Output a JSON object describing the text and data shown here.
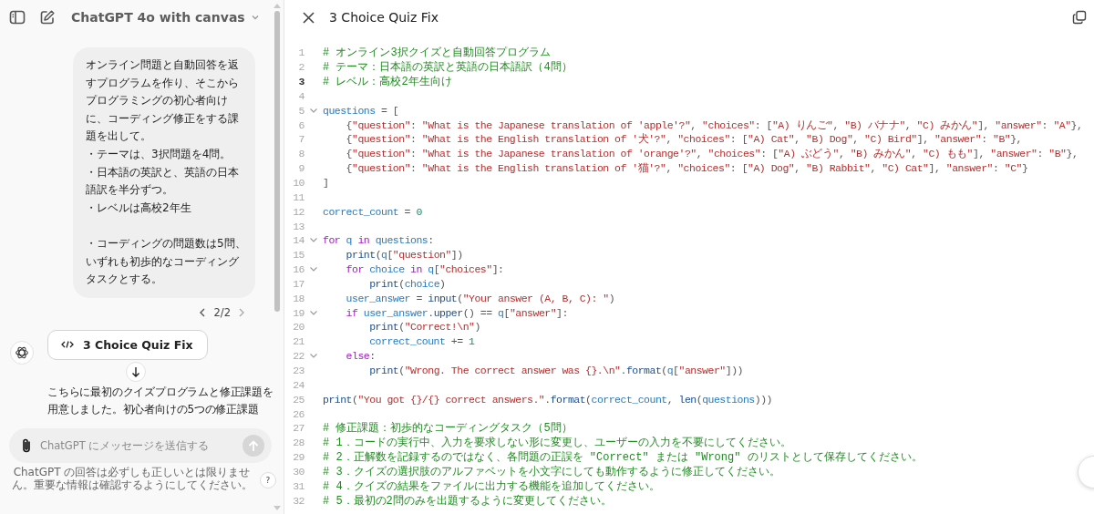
{
  "sidebar": {
    "title": "ChatGPT 4o with canvas",
    "messages": [
      {
        "kind": "user",
        "paragraphs": [
          [
            "オンライン問題と自動回答を返すプログラムを作り、そこからプログラミングの初心者向けに、コーディング修正をする課題を出して。",
            "・テーマは、3択問題を4問。",
            "・日本語の英訳と、英語の日本語訳を半分ずつ。",
            "・レベルは高校2年生"
          ],
          [
            "・コーディングの問題数は5問、いずれも初歩的なコーディングタスクとする。"
          ]
        ],
        "pager": "2/2"
      },
      {
        "kind": "assistant",
        "chip": "3 Choice Quiz Fix",
        "text": "こちらに最初のクイズプログラムと修正課題を用意しました。初心者向けの5つの修正課題"
      }
    ],
    "composer": {
      "placeholder": "ChatGPT にメッセージを送信する",
      "send_disabled": true
    },
    "disclaimer": "ChatGPT の回答は必ずしも正しいとは限りません。重要な情報は確認するようにしてください。",
    "help": "?"
  },
  "canvas": {
    "title": "3 Choice Quiz Fix",
    "lines": [
      {
        "number": "1",
        "foldable": false,
        "active": false,
        "tokens": [
          {
            "kind": "comment",
            "text": "# オンライン3択クイズと自動回答プログラム"
          }
        ]
      },
      {
        "number": "2",
        "foldable": false,
        "active": false,
        "tokens": [
          {
            "kind": "comment",
            "text": "# テーマ：日本語の英訳と英語の日本語訳（4問）"
          }
        ]
      },
      {
        "number": "3",
        "foldable": false,
        "active": true,
        "tokens": [
          {
            "kind": "comment",
            "text": "# レベル：高校2年生向け"
          }
        ]
      },
      {
        "number": "4",
        "foldable": false,
        "active": false
      },
      {
        "number": "5",
        "foldable": true,
        "active": false,
        "tokens": [
          {
            "kind": "variable",
            "text": "questions"
          },
          {
            "kind": "plain",
            "text": " = ["
          }
        ]
      },
      {
        "number": "6",
        "foldable": false,
        "active": false,
        "tokens": [
          {
            "kind": "plain",
            "text": "    {"
          },
          {
            "kind": "string",
            "text": "\"question\""
          },
          {
            "kind": "plain",
            "text": ": "
          },
          {
            "kind": "string",
            "text": "\"What is the Japanese translation of 'apple'?\""
          },
          {
            "kind": "plain",
            "text": ", "
          },
          {
            "kind": "string",
            "text": "\"choices\""
          },
          {
            "kind": "plain",
            "text": ": ["
          },
          {
            "kind": "string",
            "text": "\"A) りんご\""
          },
          {
            "kind": "plain",
            "text": ", "
          },
          {
            "kind": "string",
            "text": "\"B) バナナ\""
          },
          {
            "kind": "plain",
            "text": ", "
          },
          {
            "kind": "string",
            "text": "\"C) みかん\""
          },
          {
            "kind": "plain",
            "text": "], "
          },
          {
            "kind": "string",
            "text": "\"answer\""
          },
          {
            "kind": "plain",
            "text": ": "
          },
          {
            "kind": "string",
            "text": "\"A\""
          },
          {
            "kind": "plain",
            "text": "},"
          }
        ]
      },
      {
        "number": "7",
        "foldable": false,
        "active": false,
        "tokens": [
          {
            "kind": "plain",
            "text": "    {"
          },
          {
            "kind": "string",
            "text": "\"question\""
          },
          {
            "kind": "plain",
            "text": ": "
          },
          {
            "kind": "string",
            "text": "\"What is the English translation of '犬'?\""
          },
          {
            "kind": "plain",
            "text": ", "
          },
          {
            "kind": "string",
            "text": "\"choices\""
          },
          {
            "kind": "plain",
            "text": ": ["
          },
          {
            "kind": "string",
            "text": "\"A) Cat\""
          },
          {
            "kind": "plain",
            "text": ", "
          },
          {
            "kind": "string",
            "text": "\"B) Dog\""
          },
          {
            "kind": "plain",
            "text": ", "
          },
          {
            "kind": "string",
            "text": "\"C) Bird\""
          },
          {
            "kind": "plain",
            "text": "], "
          },
          {
            "kind": "string",
            "text": "\"answer\""
          },
          {
            "kind": "plain",
            "text": ": "
          },
          {
            "kind": "string",
            "text": "\"B\""
          },
          {
            "kind": "plain",
            "text": "},"
          }
        ]
      },
      {
        "number": "8",
        "foldable": false,
        "active": false,
        "tokens": [
          {
            "kind": "plain",
            "text": "    {"
          },
          {
            "kind": "string",
            "text": "\"question\""
          },
          {
            "kind": "plain",
            "text": ": "
          },
          {
            "kind": "string",
            "text": "\"What is the Japanese translation of 'orange'?\""
          },
          {
            "kind": "plain",
            "text": ", "
          },
          {
            "kind": "string",
            "text": "\"choices\""
          },
          {
            "kind": "plain",
            "text": ": ["
          },
          {
            "kind": "string",
            "text": "\"A) ぶどう\""
          },
          {
            "kind": "plain",
            "text": ", "
          },
          {
            "kind": "string",
            "text": "\"B) みかん\""
          },
          {
            "kind": "plain",
            "text": ", "
          },
          {
            "kind": "string",
            "text": "\"C) もも\""
          },
          {
            "kind": "plain",
            "text": "], "
          },
          {
            "kind": "string",
            "text": "\"answer\""
          },
          {
            "kind": "plain",
            "text": ": "
          },
          {
            "kind": "string",
            "text": "\"B\""
          },
          {
            "kind": "plain",
            "text": "},"
          }
        ]
      },
      {
        "number": "9",
        "foldable": false,
        "active": false,
        "tokens": [
          {
            "kind": "plain",
            "text": "    {"
          },
          {
            "kind": "string",
            "text": "\"question\""
          },
          {
            "kind": "plain",
            "text": ": "
          },
          {
            "kind": "string",
            "text": "\"What is the English translation of '猫'?\""
          },
          {
            "kind": "plain",
            "text": ", "
          },
          {
            "kind": "string",
            "text": "\"choices\""
          },
          {
            "kind": "plain",
            "text": ": ["
          },
          {
            "kind": "string",
            "text": "\"A) Dog\""
          },
          {
            "kind": "plain",
            "text": ", "
          },
          {
            "kind": "string",
            "text": "\"B) Rabbit\""
          },
          {
            "kind": "plain",
            "text": ", "
          },
          {
            "kind": "string",
            "text": "\"C) Cat\""
          },
          {
            "kind": "plain",
            "text": "], "
          },
          {
            "kind": "string",
            "text": "\"answer\""
          },
          {
            "kind": "plain",
            "text": ": "
          },
          {
            "kind": "string",
            "text": "\"C\""
          },
          {
            "kind": "plain",
            "text": "}"
          }
        ]
      },
      {
        "number": "10",
        "foldable": false,
        "active": false,
        "tokens": [
          {
            "kind": "plain",
            "text": "]"
          }
        ]
      },
      {
        "number": "11",
        "foldable": false,
        "active": false
      },
      {
        "number": "12",
        "foldable": false,
        "active": false,
        "tokens": [
          {
            "kind": "variable",
            "text": "correct_count"
          },
          {
            "kind": "plain",
            "text": " = "
          },
          {
            "kind": "number",
            "text": "0"
          }
        ]
      },
      {
        "number": "13",
        "foldable": false,
        "active": false
      },
      {
        "number": "14",
        "foldable": true,
        "active": false,
        "tokens": [
          {
            "kind": "keyword",
            "text": "for "
          },
          {
            "kind": "variable",
            "text": "q "
          },
          {
            "kind": "keyword",
            "text": "in "
          },
          {
            "kind": "variable",
            "text": "questions"
          },
          {
            "kind": "plain",
            "text": ":"
          }
        ]
      },
      {
        "number": "15",
        "foldable": false,
        "active": false,
        "tokens": [
          {
            "kind": "function",
            "text": "    print"
          },
          {
            "kind": "plain",
            "text": "("
          },
          {
            "kind": "variable",
            "text": "q"
          },
          {
            "kind": "plain",
            "text": "["
          },
          {
            "kind": "string",
            "text": "\"question\""
          },
          {
            "kind": "plain",
            "text": "])"
          }
        ]
      },
      {
        "number": "16",
        "foldable": true,
        "active": false,
        "tokens": [
          {
            "kind": "keyword",
            "text": "    for "
          },
          {
            "kind": "variable",
            "text": "choice "
          },
          {
            "kind": "keyword",
            "text": "in "
          },
          {
            "kind": "variable",
            "text": "q"
          },
          {
            "kind": "plain",
            "text": "["
          },
          {
            "kind": "string",
            "text": "\"choices\""
          },
          {
            "kind": "plain",
            "text": "]:"
          }
        ]
      },
      {
        "number": "17",
        "foldable": false,
        "active": false,
        "tokens": [
          {
            "kind": "function",
            "text": "        print"
          },
          {
            "kind": "plain",
            "text": "("
          },
          {
            "kind": "variable",
            "text": "choice"
          },
          {
            "kind": "plain",
            "text": ")"
          }
        ]
      },
      {
        "number": "18",
        "foldable": false,
        "active": false,
        "tokens": [
          {
            "kind": "variable",
            "text": "    user_answer"
          },
          {
            "kind": "plain",
            "text": " = "
          },
          {
            "kind": "function",
            "text": "input"
          },
          {
            "kind": "plain",
            "text": "("
          },
          {
            "kind": "string",
            "text": "\"Your answer (A, B, C): \""
          },
          {
            "kind": "plain",
            "text": ")"
          }
        ]
      },
      {
        "number": "19",
        "foldable": true,
        "active": false,
        "tokens": [
          {
            "kind": "keyword",
            "text": "    if "
          },
          {
            "kind": "variable",
            "text": "user_answer"
          },
          {
            "kind": "plain",
            "text": "."
          },
          {
            "kind": "function",
            "text": "upper"
          },
          {
            "kind": "plain",
            "text": "() == "
          },
          {
            "kind": "variable",
            "text": "q"
          },
          {
            "kind": "plain",
            "text": "["
          },
          {
            "kind": "string",
            "text": "\"answer\""
          },
          {
            "kind": "plain",
            "text": "]:"
          }
        ]
      },
      {
        "number": "20",
        "foldable": false,
        "active": false,
        "tokens": [
          {
            "kind": "function",
            "text": "        print"
          },
          {
            "kind": "plain",
            "text": "("
          },
          {
            "kind": "string",
            "text": "\"Correct!\\n\""
          },
          {
            "kind": "plain",
            "text": ")"
          }
        ]
      },
      {
        "number": "21",
        "foldable": false,
        "active": false,
        "tokens": [
          {
            "kind": "variable",
            "text": "        correct_count"
          },
          {
            "kind": "plain",
            "text": " += "
          },
          {
            "kind": "number",
            "text": "1"
          }
        ]
      },
      {
        "number": "22",
        "foldable": true,
        "active": false,
        "tokens": [
          {
            "kind": "keyword",
            "text": "    else"
          },
          {
            "kind": "plain",
            "text": ":"
          }
        ]
      },
      {
        "number": "23",
        "foldable": false,
        "active": false,
        "tokens": [
          {
            "kind": "function",
            "text": "        print"
          },
          {
            "kind": "plain",
            "text": "("
          },
          {
            "kind": "string",
            "text": "\"Wrong. The correct answer was {}.\\n\""
          },
          {
            "kind": "plain",
            "text": "."
          },
          {
            "kind": "function",
            "text": "format"
          },
          {
            "kind": "plain",
            "text": "("
          },
          {
            "kind": "variable",
            "text": "q"
          },
          {
            "kind": "plain",
            "text": "["
          },
          {
            "kind": "string",
            "text": "\"answer\""
          },
          {
            "kind": "plain",
            "text": "]))"
          }
        ]
      },
      {
        "number": "24",
        "foldable": false,
        "active": false
      },
      {
        "number": "25",
        "foldable": false,
        "active": false,
        "tokens": [
          {
            "kind": "function",
            "text": "print"
          },
          {
            "kind": "plain",
            "text": "("
          },
          {
            "kind": "string",
            "text": "\"You got {}/{} correct answers.\""
          },
          {
            "kind": "plain",
            "text": "."
          },
          {
            "kind": "function",
            "text": "format"
          },
          {
            "kind": "plain",
            "text": "("
          },
          {
            "kind": "variable",
            "text": "correct_count"
          },
          {
            "kind": "plain",
            "text": ", "
          },
          {
            "kind": "function",
            "text": "len"
          },
          {
            "kind": "plain",
            "text": "("
          },
          {
            "kind": "variable",
            "text": "questions"
          },
          {
            "kind": "plain",
            "text": ")))"
          }
        ]
      },
      {
        "number": "26",
        "foldable": false,
        "active": false
      },
      {
        "number": "27",
        "foldable": false,
        "active": false,
        "tokens": [
          {
            "kind": "comment",
            "text": "# 修正課題：初歩的なコーディングタスク（5問）"
          }
        ]
      },
      {
        "number": "28",
        "foldable": false,
        "active": false,
        "tokens": [
          {
            "kind": "comment",
            "text": "# 1．コードの実行中、入力を要求しない形に変更し、ユーザーの入力を不要にしてください。"
          }
        ]
      },
      {
        "number": "29",
        "foldable": false,
        "active": false,
        "tokens": [
          {
            "kind": "comment",
            "text": "# 2．正解数を記録するのではなく、各問題の正誤を \"Correct\" または \"Wrong\" のリストとして保存してください。"
          }
        ]
      },
      {
        "number": "30",
        "foldable": false,
        "active": false,
        "tokens": [
          {
            "kind": "comment",
            "text": "# 3．クイズの選択肢のアルファベットを小文字にしても動作するように修正してください。"
          }
        ]
      },
      {
        "number": "31",
        "foldable": false,
        "active": false,
        "tokens": [
          {
            "kind": "comment",
            "text": "# 4．クイズの結果をファイルに出力する機能を追加してください。"
          }
        ]
      },
      {
        "number": "32",
        "foldable": false,
        "active": false,
        "tokens": [
          {
            "kind": "comment",
            "text": "# 5．最初の2問のみを出題するように変更してください。"
          }
        ]
      }
    ]
  }
}
